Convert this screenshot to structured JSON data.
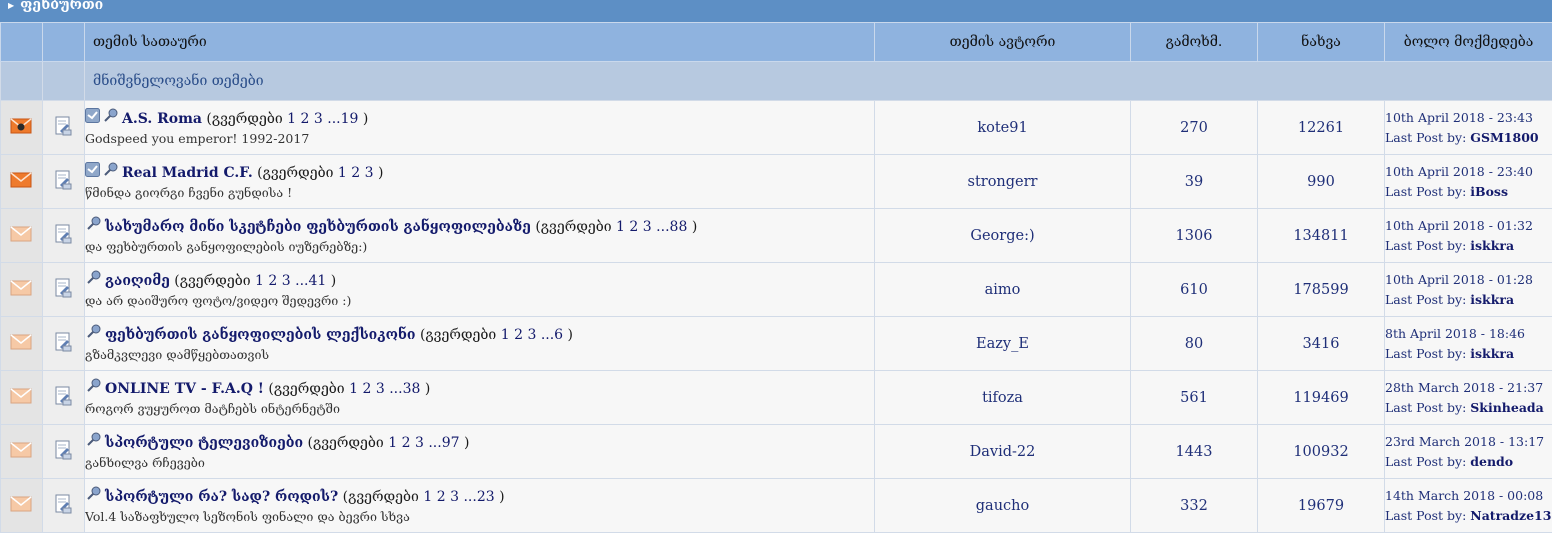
{
  "forum": {
    "title": "ფეხბურთი"
  },
  "columns": {
    "title": "თემის სათაური",
    "author": "თემის ავტორი",
    "replies": "გამოხმ.",
    "views": "ნახვა",
    "last_action": "ბოლო მოქმედება"
  },
  "section": {
    "label": "მნიშვნელოვანი თემები"
  },
  "pages_open": "(გვერდები",
  "pages_close": ")",
  "ellipsis": "...",
  "last_post_prefix": "Last Post by:",
  "colors": {
    "header": "#5d8fc5",
    "column_header": "#8fb3df",
    "section": "#b7c9e0",
    "link": "#131a6b"
  },
  "topics": [
    {
      "status": "hot-new",
      "poll": true,
      "title": "A.S. Roma",
      "pages": [
        "1",
        "2",
        "3"
      ],
      "last_page": "19",
      "subtitle": "Godspeed you emperor! 1992-2017",
      "author": "kote91",
      "replies": "270",
      "views": "12261",
      "last_date": "10th April 2018 - 23:43",
      "last_user": "GSM1800"
    },
    {
      "status": "new",
      "poll": true,
      "title": "Real Madrid C.F.",
      "pages": [
        "1",
        "2",
        "3"
      ],
      "last_page": "",
      "subtitle": "წმინდა გიორგი ჩვენი გუნდისა !",
      "author": "strongerr",
      "replies": "39",
      "views": "990",
      "last_date": "10th April 2018 - 23:40",
      "last_user": "iBoss"
    },
    {
      "status": "read",
      "poll": false,
      "title": "სახუმარო მინი სკეტჩები ფეხბურთის განყოფილებაზე",
      "pages": [
        "1",
        "2",
        "3"
      ],
      "last_page": "88",
      "subtitle": "და ფეხბურთის განყოფილების იუზერებზე:)",
      "author": "George:)",
      "replies": "1306",
      "views": "134811",
      "last_date": "10th April 2018 - 01:32",
      "last_user": "iskkra"
    },
    {
      "status": "read",
      "poll": false,
      "title": "გაიღიმე",
      "pages": [
        "1",
        "2",
        "3"
      ],
      "last_page": "41",
      "subtitle": "და არ დაიშურო ფოტო/ვიდეო შედევრი :)",
      "author": "aimo",
      "replies": "610",
      "views": "178599",
      "last_date": "10th April 2018 - 01:28",
      "last_user": "iskkra"
    },
    {
      "status": "read",
      "poll": false,
      "title": "ფეხბურთის განყოფილების ლექსიკონი",
      "pages": [
        "1",
        "2",
        "3"
      ],
      "last_page": "6",
      "subtitle": "გზამკვლევი დამწყებთათვის",
      "author": "Eazy_E",
      "replies": "80",
      "views": "3416",
      "last_date": "8th April 2018 - 18:46",
      "last_user": "iskkra"
    },
    {
      "status": "read",
      "poll": false,
      "title": "ONLINE TV - F.A.Q !",
      "pages": [
        "1",
        "2",
        "3"
      ],
      "last_page": "38",
      "subtitle": "როგორ ვუყუროთ მატჩებს ინტერნეტში",
      "author": "tifoza",
      "replies": "561",
      "views": "119469",
      "last_date": "28th March 2018 - 21:37",
      "last_user": "Skinheada"
    },
    {
      "status": "read",
      "poll": false,
      "title": "სპორტული ტელევიზიები",
      "pages": [
        "1",
        "2",
        "3"
      ],
      "last_page": "97",
      "subtitle": "განხილვა რჩევები",
      "author": "David-22",
      "replies": "1443",
      "views": "100932",
      "last_date": "23rd March 2018 - 13:17",
      "last_user": "dendo"
    },
    {
      "status": "read",
      "poll": false,
      "title": "სპორტული რა? სად? როდის?",
      "pages": [
        "1",
        "2",
        "3"
      ],
      "last_page": "23",
      "subtitle": "Vol.4 საზაფხულო სეზონის ფინალი და ბევრი სხვა",
      "author": "gaucho",
      "replies": "332",
      "views": "19679",
      "last_date": "14th March 2018 - 00:08",
      "last_user": "Natradze13"
    }
  ]
}
